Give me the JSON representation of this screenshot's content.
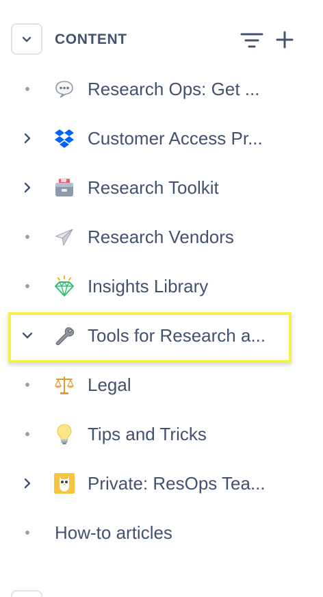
{
  "header": {
    "title": "CONTENT",
    "collapse_icon": "chevron-down-icon",
    "filter_icon": "filter-icon",
    "add_icon": "plus-icon"
  },
  "tree": {
    "items": [
      {
        "label": "Research Ops: Get ...",
        "toggle": "bullet",
        "icon": "speech-bubble-icon"
      },
      {
        "label": "Customer Access Pr...",
        "toggle": "chevron-right",
        "icon": "dropbox-icon"
      },
      {
        "label": "Research Toolkit",
        "toggle": "chevron-right",
        "icon": "card-box-icon"
      },
      {
        "label": "Research Vendors",
        "toggle": "bullet",
        "icon": "paper-plane-icon"
      },
      {
        "label": "Insights Library",
        "toggle": "bullet",
        "icon": "diamond-sparkle-icon"
      },
      {
        "label": "Tools for Research a...",
        "toggle": "chevron-down",
        "icon": "wrench-icon",
        "highlighted": true
      },
      {
        "label": "Legal",
        "toggle": "bullet",
        "icon": "balance-scale-icon"
      },
      {
        "label": "Tips and Tricks",
        "toggle": "bullet",
        "icon": "light-bulb-icon"
      },
      {
        "label": "Private: ResOps Tea...",
        "toggle": "chevron-right",
        "icon": "owl-avatar-icon"
      },
      {
        "label": "How-to articles",
        "toggle": "bullet",
        "icon": ""
      }
    ]
  },
  "colors": {
    "text": "#42526e",
    "bullet": "#97a0af",
    "highlight_border": "#f4f14a",
    "button_border": "#dfe1e6"
  }
}
